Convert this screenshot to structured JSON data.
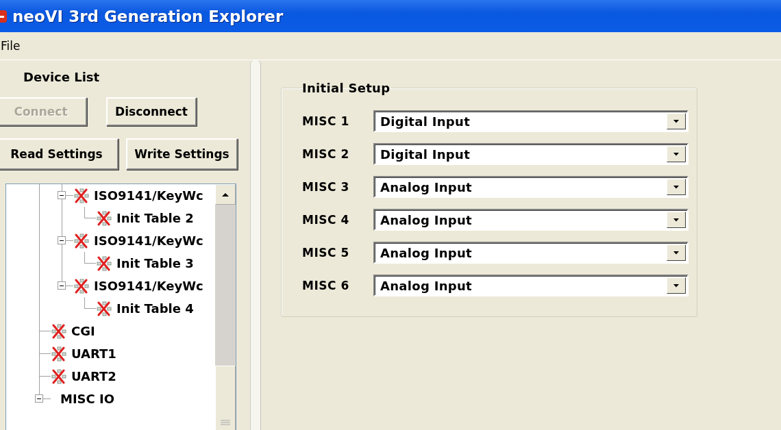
{
  "window": {
    "title": "neoVI 3rd Generation Explorer"
  },
  "menu": [
    "File"
  ],
  "device_list": {
    "title": "Device List",
    "buttons": [
      {
        "label": "Connect",
        "disabled": true
      },
      {
        "label": "Disconnect",
        "disabled": false
      },
      {
        "label": "Read Settings",
        "disabled": false
      },
      {
        "label": "Write Settings",
        "disabled": false
      }
    ],
    "tree": [
      {
        "children": [
          {
            "label": "ISO9141/KeyWc",
            "error": true,
            "expanded": true,
            "children": [
              {
                "label": "Init Table 2",
                "error": true
              }
            ]
          },
          {
            "label": "ISO9141/KeyWc",
            "error": true,
            "expanded": true,
            "children": [
              {
                "label": "Init Table 3",
                "error": true
              }
            ]
          },
          {
            "label": "ISO9141/KeyWc",
            "error": true,
            "expanded": true,
            "children": [
              {
                "label": "Init Table 4",
                "error": true
              }
            ]
          }
        ]
      },
      {
        "label": "CGI",
        "error": true
      },
      {
        "label": "UART1",
        "error": true
      },
      {
        "label": "UART2",
        "error": true
      },
      {
        "label": "MISC IO",
        "error": false,
        "expanded": true
      }
    ]
  },
  "initial_setup": {
    "title": "Initial Setup",
    "rows": [
      {
        "label": "MISC 1",
        "value": "Digital Input"
      },
      {
        "label": "MISC 2",
        "value": "Digital Input"
      },
      {
        "label": "MISC 3",
        "value": "Analog Input"
      },
      {
        "label": "MISC 4",
        "value": "Analog Input"
      },
      {
        "label": "MISC 5",
        "value": "Analog Input"
      },
      {
        "label": "MISC 6",
        "value": "Analog Input"
      }
    ]
  }
}
